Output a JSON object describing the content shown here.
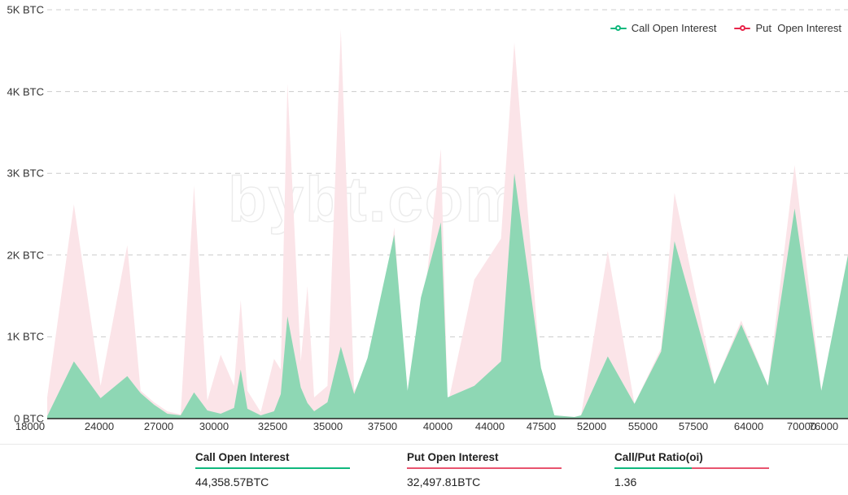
{
  "legend": {
    "items": [
      {
        "label": "Call Open Interest",
        "color": "#0fb87d",
        "name": "legend-call"
      },
      {
        "label": "Put  Open Interest",
        "color": "#e8254a",
        "name": "legend-put"
      }
    ]
  },
  "watermark": "bybt.com",
  "colors": {
    "call_fill": "#8ed7b4",
    "put_fill": "#fbe4e8",
    "call_accent": "#0fb87d",
    "put_accent": "#e8536e",
    "grid": "#cccccc",
    "axis": "#222222",
    "text": "#333333"
  },
  "stats": [
    {
      "title": "Call Open Interest",
      "value": "44,358.57BTC",
      "rule": [
        "#0fb87d"
      ],
      "name": "stat-call-open-interest"
    },
    {
      "title": "Put Open Interest",
      "value": "32,497.81BTC",
      "rule": [
        "#e8536e"
      ],
      "name": "stat-put-open-interest"
    },
    {
      "title": "Call/Put Ratio(oi)",
      "value": "1.36",
      "rule": [
        "#0fb87d",
        "#e8536e"
      ],
      "name": "stat-call-put-ratio"
    }
  ],
  "chart_data": {
    "type": "area",
    "title": "",
    "xlabel": "",
    "ylabel": "",
    "ylim": [
      0,
      5000
    ],
    "yticks": [
      0,
      1000,
      2000,
      3000,
      4000,
      5000
    ],
    "ytick_labels": [
      "0 BTC",
      "1K BTC",
      "2K BTC",
      "3K BTC",
      "4K BTC",
      "5K BTC"
    ],
    "grid": true,
    "legend_position": "top-right",
    "unit": "BTC",
    "xtick_labels": [
      "18000",
      "24000",
      "27000",
      "30000",
      "32500",
      "35000",
      "37500",
      "40000",
      "44000",
      "47500",
      "52000",
      "55000",
      "57500",
      "64000",
      "70000",
      "76000"
    ],
    "xtick_positions": [
      37,
      122,
      195,
      263,
      335,
      403,
      470,
      538,
      602,
      665,
      727,
      790,
      852,
      920,
      985,
      1035
    ],
    "x": [
      18000,
      20000,
      22000,
      24000,
      25000,
      26000,
      27000,
      28000,
      29000,
      30000,
      31000,
      32000,
      32500,
      33000,
      34000,
      35000,
      35500,
      36000,
      37000,
      37500,
      38000,
      39000,
      40000,
      41000,
      42000,
      43000,
      44000,
      45000,
      46000,
      47500,
      48000,
      50000,
      52000,
      53000,
      55000,
      56000,
      57500,
      58000,
      60000,
      62000,
      64000,
      65000,
      68000,
      70000,
      72000,
      74000,
      76000,
      78000
    ],
    "series": [
      {
        "name": "Call Open Interest",
        "color": "#8ed7b4",
        "values": [
          30,
          700,
          250,
          520,
          310,
          170,
          60,
          40,
          320,
          100,
          60,
          130,
          600,
          120,
          40,
          90,
          300,
          1250,
          380,
          190,
          90,
          200,
          880,
          300,
          740,
          1500,
          2250,
          340,
          1480,
          2400,
          260,
          400,
          700,
          3000,
          620,
          40,
          20,
          40,
          760,
          180,
          820,
          2170,
          420,
          1150,
          400,
          2570,
          340,
          2000
        ]
      },
      {
        "name": "Put Open Interest",
        "color": "#fbe4e8",
        "values": [
          260,
          2620,
          400,
          2120,
          340,
          200,
          90,
          50,
          2850,
          220,
          780,
          400,
          1450,
          340,
          80,
          730,
          600,
          4100,
          700,
          1620,
          260,
          400,
          4760,
          340,
          600,
          960,
          2340,
          220,
          1080,
          3300,
          160,
          1700,
          2200,
          4600,
          500,
          40,
          20,
          40,
          2050,
          180,
          860,
          2760,
          420,
          1200,
          400,
          3100,
          340,
          2010
        ]
      }
    ]
  }
}
